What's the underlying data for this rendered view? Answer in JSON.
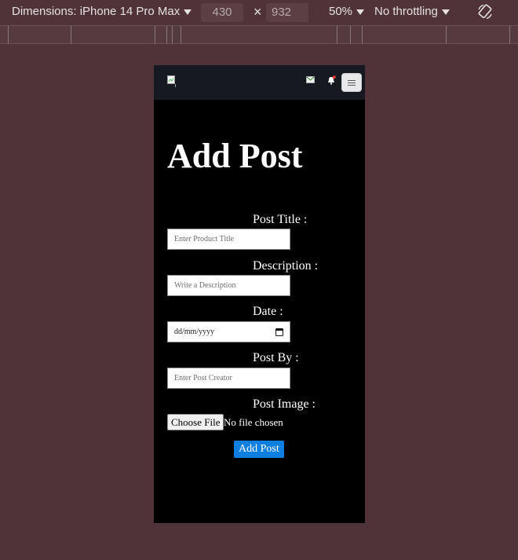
{
  "devtools": {
    "dimensions_label": "Dimensions: iPhone 14 Pro Max",
    "width": "430",
    "times": "×",
    "height": "932",
    "zoom": "50%",
    "throttling": "No throttling",
    "icons": {
      "dropdown": "caret-down-icon",
      "rotate": "rotate-icon"
    }
  },
  "navbar": {
    "icons": {
      "logo": "broken-image-icon",
      "mail": "mail-icon",
      "bell": "notification-bell-icon",
      "menu": "hamburger-menu-icon"
    },
    "notification_color": "#e53935"
  },
  "page": {
    "title": "Add Post",
    "form": {
      "title_label": "Post Title :",
      "title_placeholder": "Enter Product Title",
      "description_label": "Description :",
      "description_placeholder": "Write a Description",
      "date_label": "Date :",
      "date_value": "dd/mm/yyyy",
      "post_by_label": "Post By :",
      "post_by_placeholder": "Enter Post Creator",
      "image_label": "Post Image :",
      "choose_file": "Choose File",
      "no_file": "No file chosen",
      "submit": "Add Post"
    }
  },
  "colors": {
    "accent": "#0d7fe0",
    "page_bg": "#4f3338",
    "viewport_bg": "#000000",
    "navbar_bg": "#161a20"
  }
}
